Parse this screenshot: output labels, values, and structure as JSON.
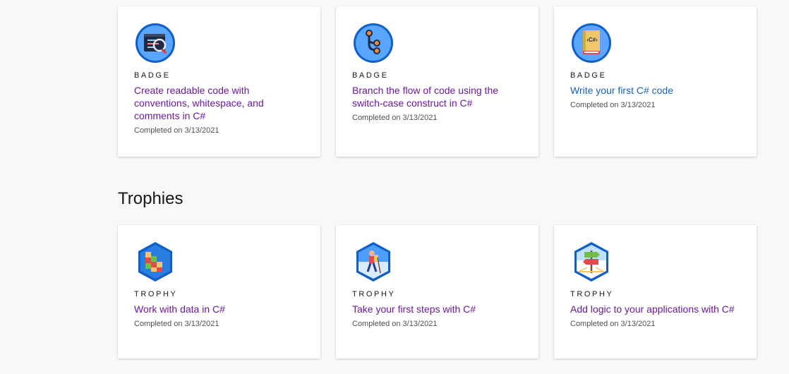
{
  "badges": [
    {
      "kind": "BADGE",
      "title": "Create readable code with conventions, whitespace, and comments in C#",
      "completed": "Completed on 3/13/2021",
      "icon": "code-window-icon"
    },
    {
      "kind": "BADGE",
      "title": "Branch the flow of code using the switch-case construct in C#",
      "completed": "Completed on 3/13/2021",
      "icon": "branch-icon"
    },
    {
      "kind": "BADGE",
      "title": "Write your first C# code",
      "completed": "Completed on 3/13/2021",
      "icon": "csharp-book-icon"
    }
  ],
  "trophies_heading": "Trophies",
  "trophies": [
    {
      "kind": "TROPHY",
      "title": "Work with data in C#",
      "completed": "Completed on 3/13/2021",
      "icon": "data-blocks-icon"
    },
    {
      "kind": "TROPHY",
      "title": "Take your first steps with C#",
      "completed": "Completed on 3/13/2021",
      "icon": "hiker-icon"
    },
    {
      "kind": "TROPHY",
      "title": "Add logic to your applications with C#",
      "completed": "Completed on 3/13/2021",
      "icon": "signpost-icon"
    }
  ],
  "colors": {
    "title_purple": "#6b1a98",
    "title_blue_link": "#1a64b8",
    "badge_circle": "#4c9eff"
  }
}
